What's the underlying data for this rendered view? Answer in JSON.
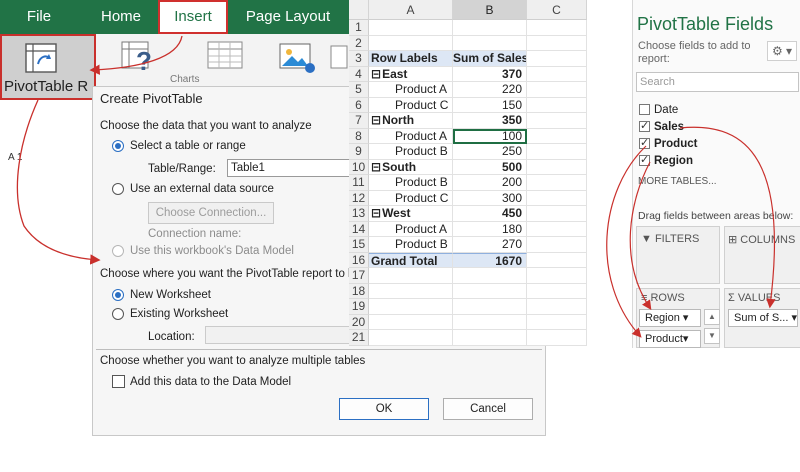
{
  "ribbon": {
    "tabs": [
      {
        "label": "File",
        "active": false
      },
      {
        "label": "Home",
        "active": false
      },
      {
        "label": "Insert",
        "active": true
      },
      {
        "label": "Page Layout",
        "active": false
      }
    ],
    "pivot_button_label": "PivotTable R",
    "charts_group_label": "Charts",
    "name_box_hint": "A 1",
    "accent": "#217346"
  },
  "dialog": {
    "title": "Create PivotTable",
    "section1": "Choose the data that you want to analyze",
    "opt_range": "Select a table or range",
    "table_range_label": "Table/Range:",
    "table_range_value": "Table1",
    "opt_external": "Use an external data source",
    "choose_connection": "Choose Connection...",
    "connection_name": "Connection name:",
    "opt_data_model": "Use this workbook's Data Model",
    "section2": "Choose where you want the PivotTable report to b",
    "opt_new_ws": "New Worksheet",
    "opt_existing_ws": "Existing Worksheet",
    "location_label": "Location:",
    "section3": "Choose whether you want to analyze multiple tables",
    "add_data_model": "Add this data to the Data Model",
    "ok": "OK",
    "cancel": "Cancel"
  },
  "sheet": {
    "columns": [
      "A",
      "B",
      "C"
    ],
    "row_numbers": [
      "1",
      "2",
      "3",
      "4",
      "5",
      "6",
      "7",
      "8",
      "9",
      "10",
      "11",
      "12",
      "13",
      "14",
      "15",
      "16",
      "17",
      "18",
      "19",
      "20",
      "21"
    ],
    "header": {
      "row_labels": "Row Labels",
      "sum_of_sales": "Sum of Sales"
    },
    "rows": [
      {
        "label": "East",
        "value": "370",
        "level": "region"
      },
      {
        "label": "Product A",
        "value": "220",
        "level": "product"
      },
      {
        "label": "Product C",
        "value": "150",
        "level": "product"
      },
      {
        "label": "North",
        "value": "350",
        "level": "region"
      },
      {
        "label": "Product A",
        "value": "100",
        "level": "product"
      },
      {
        "label": "Product B",
        "value": "250",
        "level": "product"
      },
      {
        "label": "South",
        "value": "500",
        "level": "region"
      },
      {
        "label": "Product B",
        "value": "200",
        "level": "product"
      },
      {
        "label": "Product C",
        "value": "300",
        "level": "product"
      },
      {
        "label": "West",
        "value": "450",
        "level": "region"
      },
      {
        "label": "Product A",
        "value": "180",
        "level": "product"
      },
      {
        "label": "Product B",
        "value": "270",
        "level": "product"
      }
    ],
    "grand_total": {
      "label": "Grand Total",
      "value": "1670"
    },
    "collapse_glyph": "⊟"
  },
  "pane": {
    "title": "PivotTable Fields",
    "subtitle_line1": "Choose fields to add to",
    "subtitle_line2": "report:",
    "search_placeholder": "Search",
    "fields": [
      {
        "label": "Date",
        "checked": false
      },
      {
        "label": "Sales",
        "checked": true
      },
      {
        "label": "Product",
        "checked": true
      },
      {
        "label": "Region",
        "checked": true
      }
    ],
    "more_tables": "MORE TABLES...",
    "drag_hint": "Drag fields between areas below:",
    "filters": "FILTERS",
    "columns": "COLUMNS",
    "rows": "ROWS",
    "values": "VALUES",
    "rows_items": [
      "Region",
      "Product"
    ],
    "values_items": [
      "Sum of S..."
    ]
  }
}
